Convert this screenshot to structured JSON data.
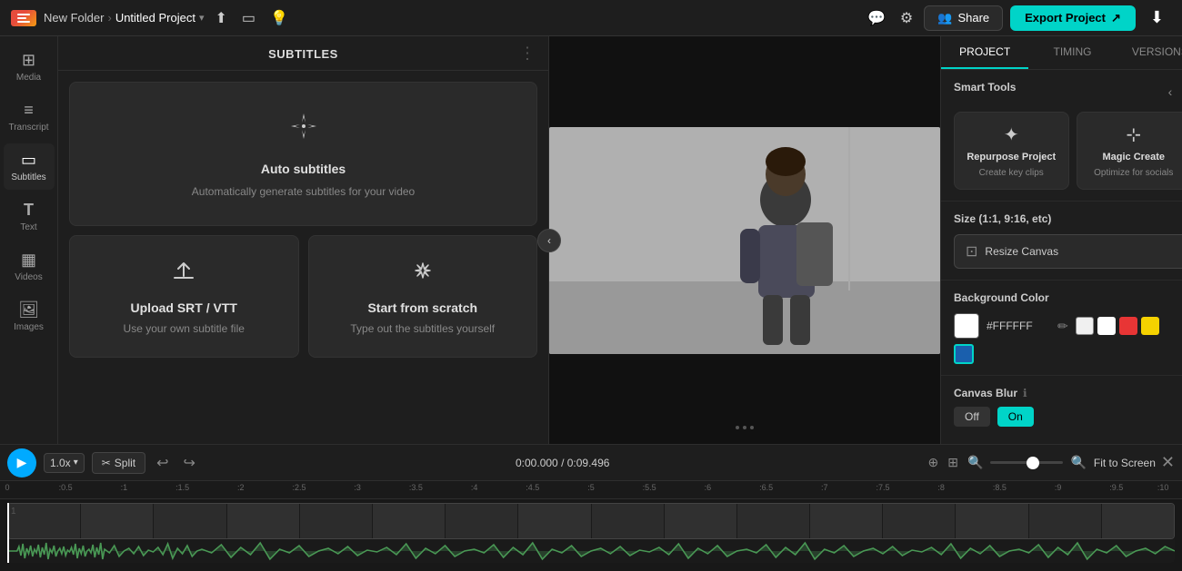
{
  "topbar": {
    "folder": "New Folder",
    "sep": "›",
    "project": "Untitled Project",
    "share_label": "Share",
    "export_label": "Export Project"
  },
  "sidebar": {
    "items": [
      {
        "id": "media",
        "label": "Media",
        "icon": "⊞"
      },
      {
        "id": "transcript",
        "label": "Transcript",
        "icon": "≡"
      },
      {
        "id": "subtitles",
        "label": "Subtitles",
        "icon": "▭"
      },
      {
        "id": "text",
        "label": "Text",
        "icon": "T"
      },
      {
        "id": "videos",
        "label": "Videos",
        "icon": "▦"
      },
      {
        "id": "images",
        "label": "Images",
        "icon": "🖼"
      }
    ]
  },
  "subtitles_panel": {
    "title": "SUBTITLES",
    "auto_title": "Auto subtitles",
    "auto_desc": "Automatically generate subtitles for your video",
    "upload_title": "Upload SRT / VTT",
    "upload_desc": "Use your own subtitle file",
    "scratch_title": "Start from scratch",
    "scratch_desc": "Type out the subtitles yourself"
  },
  "right_panel": {
    "tabs": [
      "PROJECT",
      "TIMING",
      "VERSIONS"
    ],
    "active_tab": "PROJECT",
    "smart_tools_title": "Smart Tools",
    "repurpose_title": "Repurpose Project",
    "repurpose_desc": "Create key clips",
    "magic_title": "Magic Create",
    "magic_desc": "Optimize for socials",
    "size_title": "Size (1:1, 9:16, etc)",
    "resize_label": "Resize Canvas",
    "bg_color_title": "Background Color",
    "color_hex": "#FFFFFF",
    "canvas_blur_title": "Canvas Blur",
    "blur_off": "Off",
    "blur_on": "On"
  },
  "timeline_bar": {
    "speed": "1.0x",
    "split_label": "Split",
    "time_current": "0:00.000",
    "time_sep": "/",
    "time_total": "0:09.496",
    "fit_screen": "Fit to Screen"
  },
  "ruler": {
    "marks": [
      "0",
      ":0.5",
      ":1",
      ":1.5",
      ":2",
      ":2.5",
      ":3",
      ":3.5",
      ":4",
      ":4.5",
      ":5",
      ":5.5",
      ":6",
      ":6.5",
      ":7",
      ":7.5",
      ":8",
      ":8.5",
      ":9",
      ":9.5",
      ":10"
    ]
  },
  "colors": {
    "primary": "#00d4c8",
    "play_blue": "#0099ff",
    "bg_dark": "#1a1a1a",
    "panel_bg": "#1e1e1e"
  }
}
